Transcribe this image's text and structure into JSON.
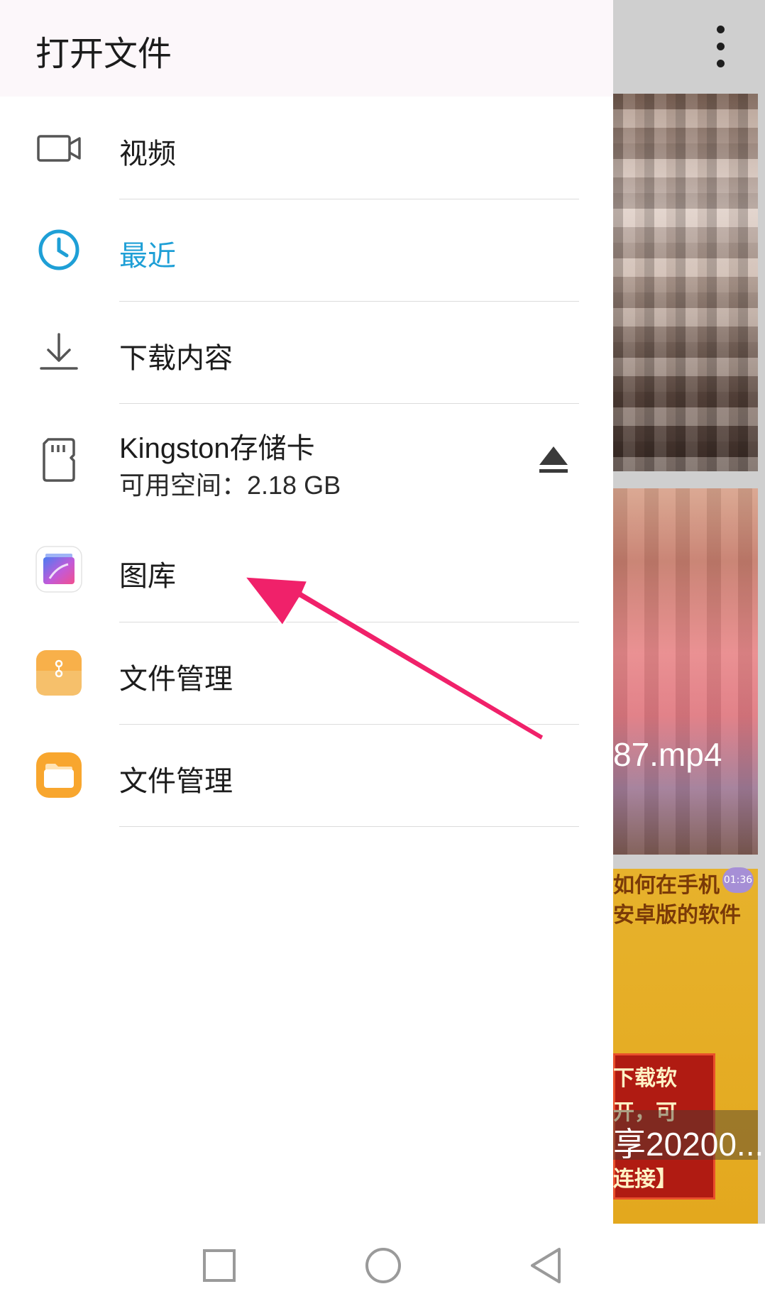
{
  "background": {
    "thumbnails": [
      {
        "label": ""
      },
      {
        "label": "87.mp4"
      },
      {
        "label": "享20200...",
        "text_lines": [
          "如何在手机",
          "安卓版的软件"
        ],
        "badge": "01:36",
        "panel_lines": [
          "下载软",
          "开，可",
          "连接】"
        ]
      }
    ]
  },
  "drawer": {
    "title": "打开文件",
    "items": [
      {
        "label": "视频",
        "icon": "video-icon"
      },
      {
        "label": "最近",
        "icon": "clock-icon",
        "selected": true,
        "color": "#1e9fd6"
      },
      {
        "label": "下载内容",
        "icon": "download-icon"
      },
      {
        "label": "Kingston存储卡",
        "sublabel": "可用空间：2.18 GB",
        "icon": "sd-card-icon",
        "action_icon": "eject-icon"
      },
      {
        "label": "图库",
        "icon": "gallery-app-icon"
      },
      {
        "label": "文件管理",
        "icon": "file-manager-app-icon"
      },
      {
        "label": "文件管理",
        "icon": "folder-app-icon"
      }
    ]
  },
  "annotation": {
    "color": "#f0216a",
    "points_to": "图库"
  },
  "navbar": {
    "buttons": [
      "recent-apps-icon",
      "home-icon",
      "back-icon"
    ]
  }
}
